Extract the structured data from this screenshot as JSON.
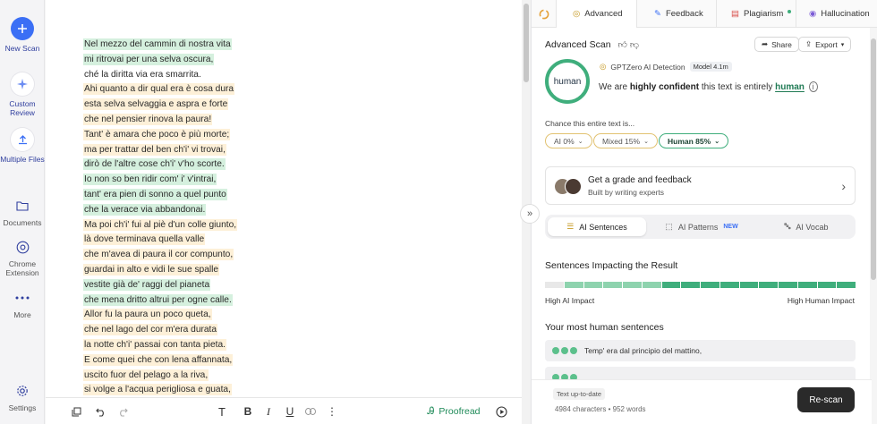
{
  "rail": {
    "new_scan": "New Scan",
    "custom_review": "Custom Review",
    "multiple_files": "Multiple Files",
    "documents": "Documents",
    "chrome_extension": "Chrome Extension",
    "more": "More",
    "settings": "Settings"
  },
  "poem": [
    {
      "text": "Nel mezzo del cammin di nostra vita",
      "style": "green"
    },
    {
      "text": "mi ritrovai per una selva oscura,",
      "style": "green"
    },
    {
      "text": "ché la diritta via era smarrita.",
      "style": "none"
    },
    {
      "text": "Ahi quanto a dir qual era è cosa dura",
      "style": "yellow"
    },
    {
      "text": "esta selva selvaggia e aspra e forte",
      "style": "yellow"
    },
    {
      "text": "che nel pensier rinova la paura!",
      "style": "yellow"
    },
    {
      "text": "Tant' è amara che poco è più morte;",
      "style": "yellow"
    },
    {
      "text": "ma per trattar del ben ch'i' vi trovai,",
      "style": "yellow"
    },
    {
      "text": "dirò de l'altre cose ch'i' v'ho scorte.",
      "style": "green"
    },
    {
      "text": "Io non so ben ridir com' i' v'intrai,",
      "style": "green"
    },
    {
      "text": "tant' era pien di sonno a quel punto",
      "style": "green"
    },
    {
      "text": "che la verace via abbandonai.",
      "style": "green"
    },
    {
      "text": "Ma poi ch'i' fui al piè d'un colle giunto,",
      "style": "yellow"
    },
    {
      "text": "là dove terminava quella valle",
      "style": "yellow"
    },
    {
      "text": "che m'avea di paura il cor compunto,",
      "style": "yellow"
    },
    {
      "text": "guardai in alto e vidi le sue spalle",
      "style": "yellow"
    },
    {
      "text": "vestite già de' raggi del pianeta",
      "style": "green"
    },
    {
      "text": "che mena dritto altrui per ogne calle.",
      "style": "green"
    },
    {
      "text": "Allor fu la paura un poco queta,",
      "style": "yellow"
    },
    {
      "text": "che nel lago del cor m'era durata",
      "style": "yellow"
    },
    {
      "text": "la notte ch'i' passai con tanta pieta.",
      "style": "yellow"
    },
    {
      "text": "E come quei che con lena affannata,",
      "style": "yellow"
    },
    {
      "text": "uscito fuor del pelago a la riva,",
      "style": "yellow"
    },
    {
      "text": "si volge a l'acqua perigliosa e guata,",
      "style": "yellow"
    }
  ],
  "toolbar": {
    "proofread": "Proofread"
  },
  "tabs": {
    "advanced": "Advanced",
    "feedback": "Feedback",
    "plagiarism": "Plagiarism",
    "hallucination": "Hallucination"
  },
  "scan": {
    "title": "Advanced Scan",
    "share": "Share",
    "export": "Export",
    "gauge_label": "human",
    "detector": "GPTZero AI Detection",
    "model": "Model 4.1m",
    "conf_prefix": "We are",
    "conf_strong": "highly confident",
    "conf_mid": "this text is entirely",
    "conf_result": "human",
    "chance_label": "Chance this entire text is...",
    "chips": [
      "AI 0%",
      "Mixed 15%",
      "Human 85%"
    ]
  },
  "card": {
    "title": "Get a grade and feedback",
    "subtitle": "Built by writing experts"
  },
  "segments": {
    "ai_sentences": "AI Sentences",
    "ai_patterns": "AI Patterns",
    "new_badge": "NEW",
    "ai_vocab": "AI Vocab"
  },
  "impact": {
    "title": "Sentences Impacting the Result",
    "left": "High AI Impact",
    "right": "High Human Impact"
  },
  "human_sentences": {
    "title": "Your most human sentences",
    "items": [
      "Temp' era dal principio del mattino,"
    ]
  },
  "footer": {
    "up_to_date": "Text up-to-date",
    "stats": "4984 characters • 952 words",
    "rescan": "Re-scan"
  },
  "colors": {
    "accent_blue": "#3b6ff5",
    "human_green": "#3fae7c",
    "ai_yellow": "#e2c271"
  }
}
